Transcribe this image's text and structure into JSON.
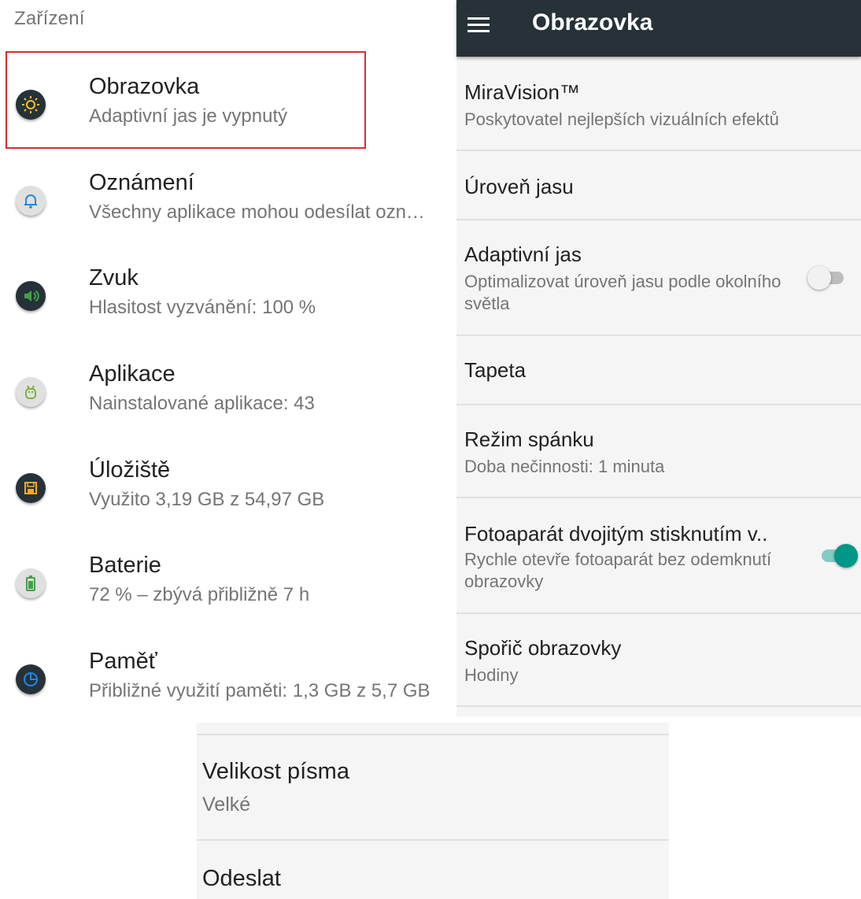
{
  "left_panel": {
    "section_header": "Zařízení",
    "items": [
      {
        "title": "Obrazovka",
        "subtitle": "Adaptivní jas je vypnutý",
        "icon": "brightness-icon",
        "icon_bg": "#263238",
        "icon_color": "#fbc02d"
      },
      {
        "title": "Oznámení",
        "subtitle": "Všechny aplikace mohou odesílat ozn…",
        "icon": "bell-icon",
        "icon_bg": "#e0e0e0",
        "icon_color": "#1e88e5"
      },
      {
        "title": "Zvuk",
        "subtitle": "Hlasitost vyzvánění: 100 %",
        "icon": "volume-icon",
        "icon_bg": "#263238",
        "icon_color": "#43a047"
      },
      {
        "title": "Aplikace",
        "subtitle": "Nainstalované aplikace: 43",
        "icon": "android-icon",
        "icon_bg": "#e0e0e0",
        "icon_color": "#7cb342"
      },
      {
        "title": "Úložiště",
        "subtitle": "Využito 3,19 GB z 54,97 GB",
        "icon": "storage-icon",
        "icon_bg": "#263238",
        "icon_color": "#f9a825"
      },
      {
        "title": "Baterie",
        "subtitle": "72 % – zbývá přibližně 7 h",
        "icon": "battery-icon",
        "icon_bg": "#e0e0e0",
        "icon_color": "#43a047"
      },
      {
        "title": "Paměť",
        "subtitle": "Přibližné využití paměti: 1,3 GB z 5,7 GB",
        "icon": "memory-icon",
        "icon_bg": "#263238",
        "icon_color": "#1e88e5"
      }
    ]
  },
  "right_panel": {
    "app_bar_title": "Obrazovka",
    "items": [
      {
        "title": "MiraVision™",
        "subtitle": "Poskytovatel nejlepších vizuálních efektů"
      },
      {
        "title": "Úroveň jasu"
      },
      {
        "title": "Adaptivní jas",
        "subtitle": "Optimalizovat úroveň jasu podle okolního světla",
        "toggle": "off"
      },
      {
        "title": "Tapeta"
      },
      {
        "title": "Režim spánku",
        "subtitle": "Doba nečinnosti: 1 minuta"
      },
      {
        "title": "Fotoaparát dvojitým stisknutím v..",
        "subtitle": "Rychle otevře fotoaparát bez odemknutí obrazovky",
        "toggle": "on"
      },
      {
        "title": "Spořič obrazovky",
        "subtitle": "Hodiny"
      }
    ]
  },
  "bottom_panel": {
    "items": [
      {
        "title": "Velikost písma",
        "subtitle": "Velké"
      },
      {
        "title": "Odeslat"
      }
    ]
  },
  "colors": {
    "app_bar": "#263238",
    "accent": "#009688",
    "highlight_border": "#d32f2f"
  }
}
